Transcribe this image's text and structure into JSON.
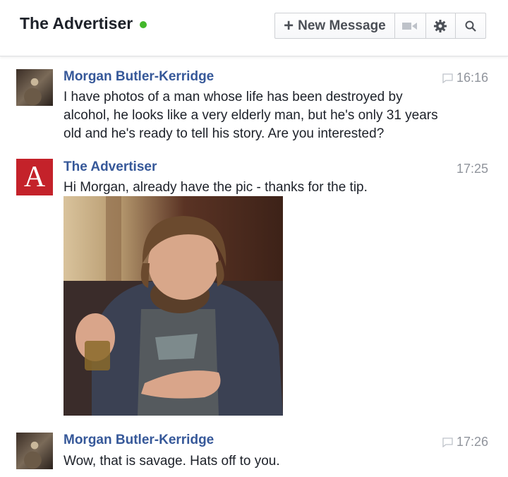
{
  "header": {
    "title": "The Advertiser",
    "status": "online",
    "status_color": "#42b72a",
    "new_message_label": "New Message",
    "icons": [
      "plus-icon",
      "video-camera-icon",
      "gear-icon",
      "search-icon"
    ]
  },
  "messages": [
    {
      "sender": "Morgan Butler-Kerridge",
      "time": "16:16",
      "text": "I have photos of a man whose life has been destroyed by alcohol, he looks like a very elderly man, but he's only 31 years old and he's ready to tell his story. Are you interested?",
      "seen_icon": "chat-bubble-icon"
    },
    {
      "sender": "The Advertiser",
      "avatar_letter": "A",
      "time": "17:25",
      "text": "Hi Morgan, already have the pic - thanks for the tip.",
      "attachment": "photo"
    },
    {
      "sender": "Morgan Butler-Kerridge",
      "time": "17:26",
      "text": "Wow, that is savage. Hats off to you.",
      "seen_icon": "chat-bubble-icon"
    }
  ],
  "colors": {
    "sender_link": "#365899",
    "timestamp": "#90949c",
    "advertiser_brand": "#c4222a"
  }
}
